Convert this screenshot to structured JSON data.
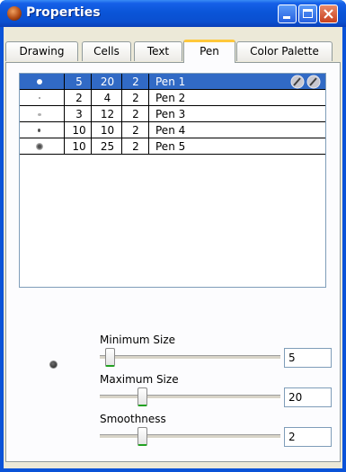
{
  "window": {
    "title": "Properties"
  },
  "tabs": [
    {
      "label": "Drawing"
    },
    {
      "label": "Cells"
    },
    {
      "label": "Text"
    },
    {
      "label": "Pen"
    },
    {
      "label": "Color Palette"
    }
  ],
  "active_tab": "Pen",
  "toolbar": {
    "add_symbol": "+",
    "remove_symbol": "−"
  },
  "pens": [
    {
      "min": "5",
      "max": "20",
      "smooth": "2",
      "name": "Pen 1",
      "selected": true
    },
    {
      "min": "2",
      "max": "4",
      "smooth": "2",
      "name": "Pen 2",
      "selected": false
    },
    {
      "min": "3",
      "max": "12",
      "smooth": "2",
      "name": "Pen 3",
      "selected": false
    },
    {
      "min": "10",
      "max": "10",
      "smooth": "2",
      "name": "Pen 4",
      "selected": false
    },
    {
      "min": "10",
      "max": "25",
      "smooth": "2",
      "name": "Pen 5",
      "selected": false
    }
  ],
  "sliders": {
    "min_size": {
      "label": "Minimum Size",
      "value": "5",
      "fraction": 0.03
    },
    "max_size": {
      "label": "Maximum Size",
      "value": "20",
      "fraction": 0.22
    },
    "smoothness": {
      "label": "Smoothness",
      "value": "2",
      "fraction": 0.22
    }
  },
  "colors": {
    "selection": "#316ac5",
    "title_bar": "#0a55d8",
    "tab_highlight": "#ffc83c"
  },
  "icons": [
    "app-icon",
    "minimize-icon",
    "maximize-icon",
    "close-icon",
    "add-icon",
    "remove-icon",
    "pencil-icon"
  ]
}
